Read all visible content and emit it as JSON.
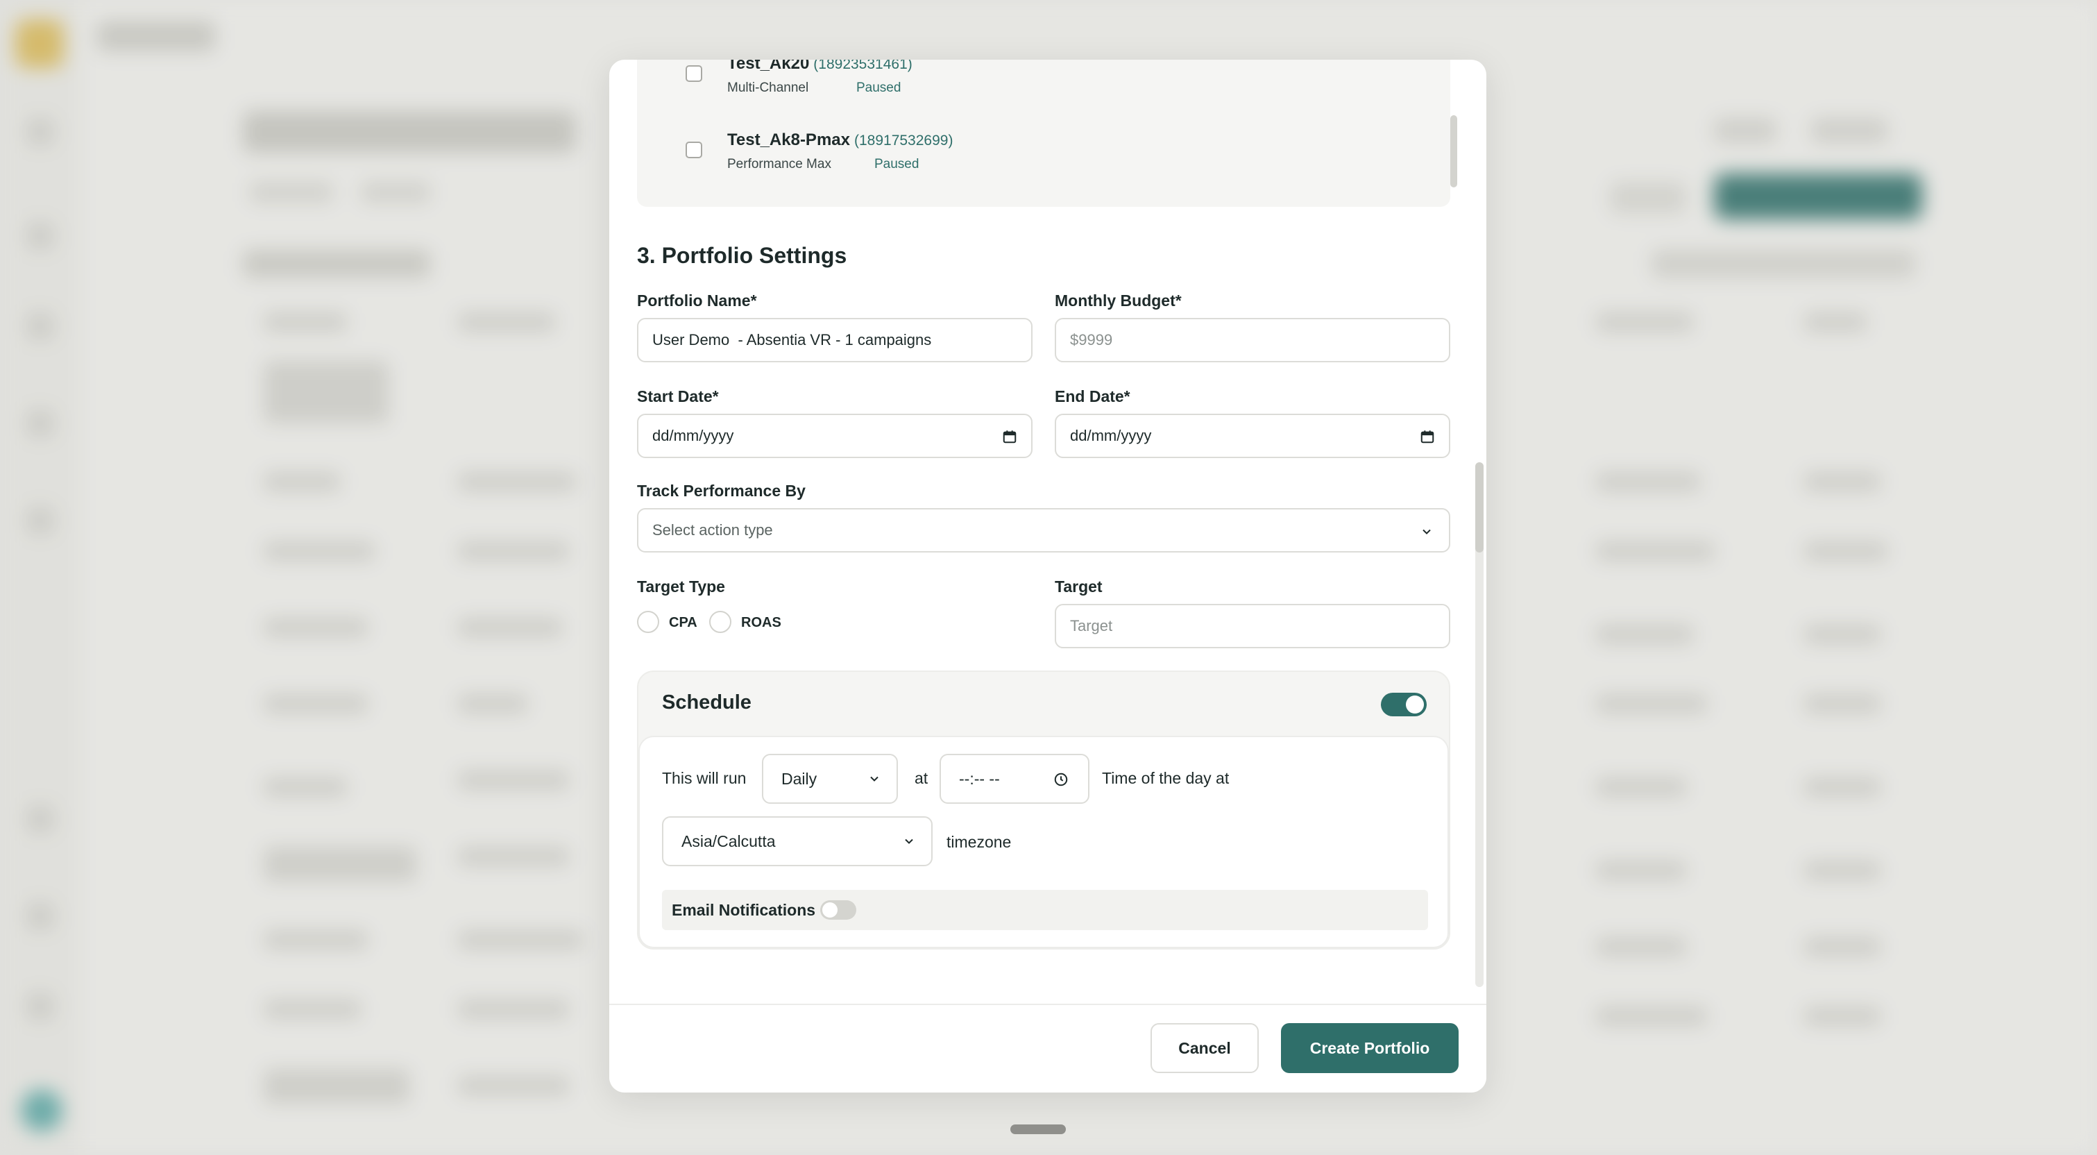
{
  "campaigns": [
    {
      "name": "Test_Ak20",
      "id": "(18923531461)",
      "type": "Multi-Channel",
      "status": "Paused"
    },
    {
      "name": "Test_Ak8-Pmax",
      "id": "(18917532699)",
      "type": "Performance Max",
      "status": "Paused"
    }
  ],
  "section_title": "3. Portfolio Settings",
  "portfolio_name": {
    "label": "Portfolio Name*",
    "value": "User Demo  - Absentia VR - 1 campaigns"
  },
  "monthly_budget": {
    "label": "Monthly Budget*",
    "placeholder": "$9999"
  },
  "start_date": {
    "label": "Start Date*",
    "placeholder": "dd/mm/yyyy"
  },
  "end_date": {
    "label": "End Date*",
    "placeholder": "dd/mm/yyyy"
  },
  "track_performance": {
    "label": "Track Performance By",
    "placeholder": "Select action type"
  },
  "target_type": {
    "label": "Target Type",
    "options": [
      "CPA",
      "ROAS"
    ]
  },
  "target": {
    "label": "Target",
    "placeholder": "Target"
  },
  "schedule": {
    "title": "Schedule",
    "enabled": true,
    "run_prefix": "This will run",
    "frequency": "Daily",
    "at_label": "at",
    "time_placeholder": "--:-- --",
    "time_suffix": "Time of the day at",
    "timezone": "Asia/Calcutta",
    "timezone_label": "timezone",
    "email_notifications_label": "Email Notifications",
    "email_notifications_enabled": false
  },
  "footer": {
    "cancel_label": "Cancel",
    "create_label": "Create Portfolio"
  },
  "colors": {
    "accent": "#2f6f6a",
    "id_text": "#2f6f6a",
    "panel_bg": "#f5f5f3"
  },
  "icons": {
    "calendar": "calendar-icon",
    "chevron": "chevron-down-icon",
    "clock": "clock-icon"
  }
}
